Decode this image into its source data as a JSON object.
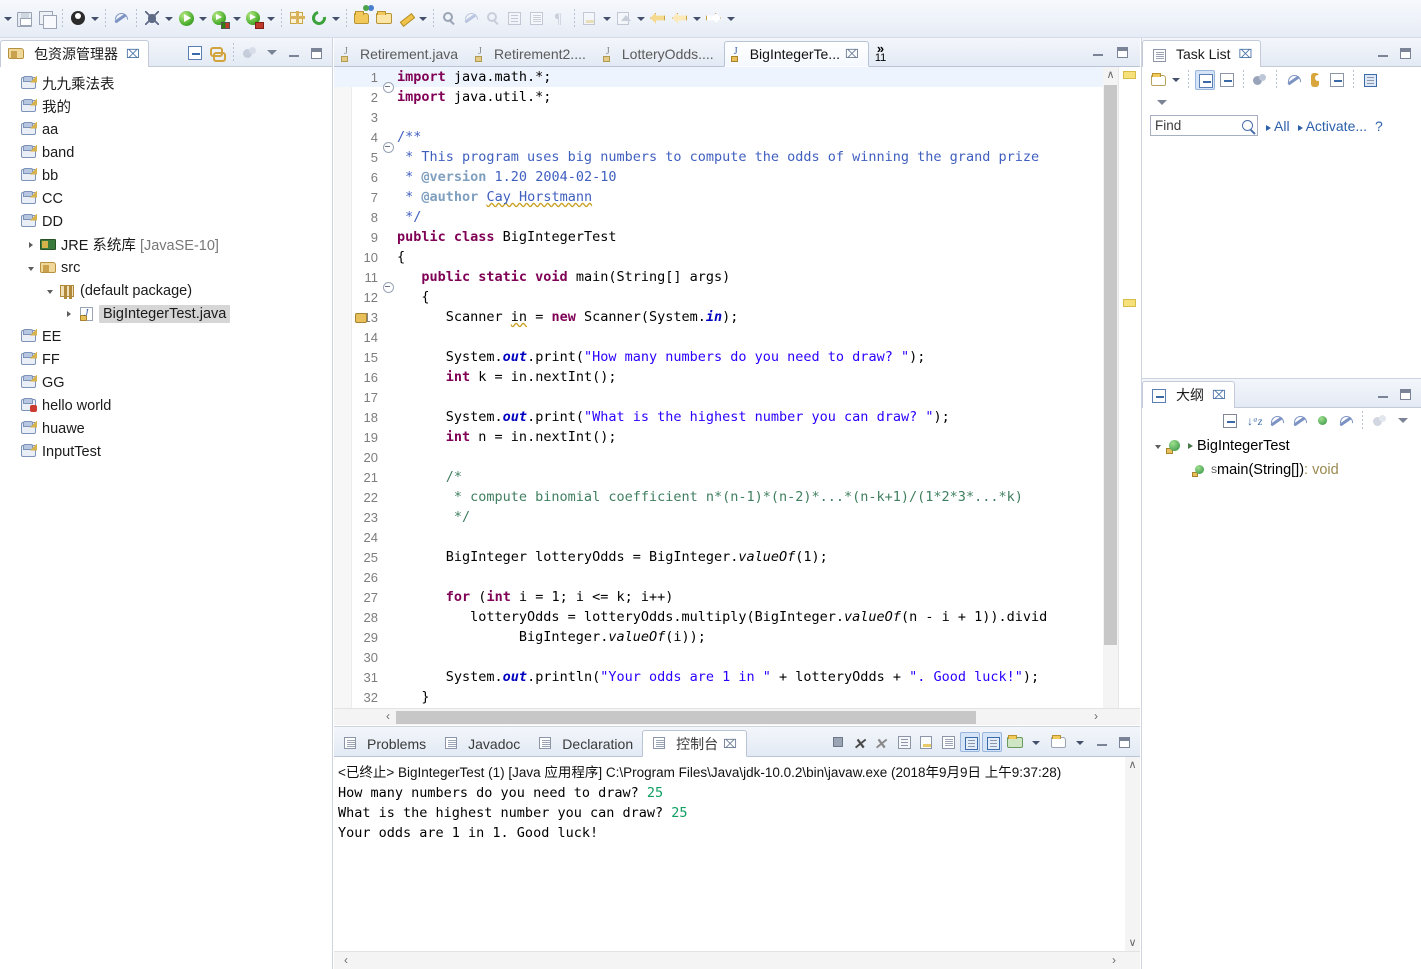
{
  "toolbar": {
    "items": [
      {
        "name": "dropdown-arrow-leading",
        "icon": "arrow"
      },
      {
        "name": "save-button",
        "icon": "save"
      },
      {
        "name": "save-all-button",
        "icon": "save-all"
      },
      {
        "name": "sep"
      },
      {
        "name": "skip-breakpoints-button",
        "icon": "person"
      },
      {
        "name": "dropdown-arrow",
        "icon": "arrow"
      },
      {
        "name": "sep"
      },
      {
        "name": "toggle-breakpoint-button",
        "icon": "pen"
      },
      {
        "name": "sep"
      },
      {
        "name": "debug-button",
        "icon": "bug"
      },
      {
        "name": "dropdown-arrow",
        "icon": "arrow"
      },
      {
        "name": "run-button",
        "icon": "run"
      },
      {
        "name": "dropdown-arrow",
        "icon": "arrow"
      },
      {
        "name": "run-coverage-button",
        "icon": "run-green"
      },
      {
        "name": "dropdown-arrow",
        "icon": "arrow"
      },
      {
        "name": "run-external-button",
        "icon": "run-red"
      },
      {
        "name": "dropdown-arrow",
        "icon": "arrow"
      },
      {
        "name": "sep"
      },
      {
        "name": "new-package-button",
        "icon": "gift"
      },
      {
        "name": "refresh-button",
        "icon": "refresh"
      },
      {
        "name": "dropdown-arrow",
        "icon": "arrow"
      },
      {
        "name": "sep"
      },
      {
        "name": "new-java-project-button",
        "icon": "new-folder"
      },
      {
        "name": "open-type-button",
        "icon": "open-folder"
      },
      {
        "name": "add-bookmark-button",
        "icon": "marker"
      },
      {
        "name": "dropdown-arrow",
        "icon": "arrow"
      },
      {
        "name": "sep"
      },
      {
        "name": "search-button",
        "icon": "search"
      },
      {
        "name": "profile-button",
        "icon": "faint-a"
      },
      {
        "name": "open-task-button",
        "icon": "faint-b"
      },
      {
        "name": "open-declaration-button",
        "icon": "book"
      },
      {
        "name": "show-whitespace-button",
        "icon": "lines"
      },
      {
        "name": "toggle-mark-occurrences-button",
        "icon": "pilcrow"
      },
      {
        "name": "sep"
      },
      {
        "name": "next-annotation-button",
        "icon": "next-annotation"
      },
      {
        "name": "dropdown-arrow",
        "icon": "arrow"
      },
      {
        "name": "last-edit-location-button",
        "icon": "last-edit"
      },
      {
        "name": "dropdown-arrow",
        "icon": "arrow"
      },
      {
        "name": "back-button",
        "icon": "back-yellow"
      },
      {
        "name": "back-history-button",
        "icon": "back-pale"
      },
      {
        "name": "dropdown-arrow",
        "icon": "arrow"
      },
      {
        "name": "forward-button",
        "icon": "forward"
      },
      {
        "name": "dropdown-arrow",
        "icon": "arrow"
      }
    ]
  },
  "package_explorer": {
    "title": "包资源管理器",
    "close_label": "⌧",
    "tools": [
      "collapse-all-icon",
      "link-with-editor-icon",
      "sync-icon",
      "view-menu-icon",
      "minimize-icon",
      "maximize-icon"
    ],
    "tree": [
      {
        "label": "九九乘法表",
        "icon": "project",
        "indent": 0,
        "twisty": "none",
        "selected": false
      },
      {
        "label": "我的",
        "icon": "project",
        "indent": 0,
        "twisty": "none",
        "selected": false
      },
      {
        "label": "aa",
        "icon": "project",
        "indent": 0,
        "twisty": "none",
        "selected": false
      },
      {
        "label": "band",
        "icon": "project",
        "indent": 0,
        "twisty": "none",
        "selected": false
      },
      {
        "label": "bb",
        "icon": "project",
        "indent": 0,
        "twisty": "none",
        "selected": false
      },
      {
        "label": "CC",
        "icon": "project",
        "indent": 0,
        "twisty": "none",
        "selected": false
      },
      {
        "label": "DD",
        "icon": "project",
        "indent": 0,
        "twisty": "none",
        "selected": false
      },
      {
        "label": "JRE 系统库",
        "dim": " [JavaSE-10]",
        "icon": "jre",
        "indent": 1,
        "twisty": "right",
        "selected": false
      },
      {
        "label": "src",
        "icon": "source-folder",
        "indent": 1,
        "twisty": "down",
        "selected": false
      },
      {
        "label": "(default package)",
        "icon": "package",
        "indent": 2,
        "twisty": "down",
        "selected": false
      },
      {
        "label": "BigIntegerTest.java",
        "icon": "java-file",
        "indent": 3,
        "twisty": "right",
        "selected": true
      },
      {
        "label": "EE",
        "icon": "project",
        "indent": 0,
        "twisty": "none",
        "selected": false
      },
      {
        "label": "FF",
        "icon": "project",
        "indent": 0,
        "twisty": "none",
        "selected": false
      },
      {
        "label": "GG",
        "icon": "project",
        "indent": 0,
        "twisty": "none",
        "selected": false
      },
      {
        "label": "hello world",
        "icon": "project-error",
        "indent": 0,
        "twisty": "none",
        "selected": false
      },
      {
        "label": "huawe",
        "icon": "project",
        "indent": 0,
        "twisty": "none",
        "selected": false
      },
      {
        "label": "InputTest",
        "icon": "project",
        "indent": 0,
        "twisty": "none",
        "selected": false
      }
    ]
  },
  "editor": {
    "tabs": [
      {
        "label": "Retirement.java",
        "active": false,
        "closeable": false
      },
      {
        "label": "Retirement2....",
        "active": false,
        "closeable": false
      },
      {
        "label": "LotteryOdds....",
        "active": false,
        "closeable": false
      },
      {
        "label": "BigIntegerTe...",
        "active": true,
        "closeable": true,
        "close_label": "⌧"
      }
    ],
    "more_tabs_chevron": "»",
    "more_tabs_count": "11",
    "restore_label": "restore-icon",
    "maximize_label": "maximize-icon",
    "lines": [
      {
        "n": "1",
        "fold": true,
        "highlight": true,
        "breakpoint": false,
        "tokens": [
          {
            "t": "import ",
            "c": "kw"
          },
          {
            "t": "java.math.*;",
            "c": ""
          }
        ]
      },
      {
        "n": "2",
        "fold": false,
        "highlight": false,
        "breakpoint": false,
        "tokens": [
          {
            "t": "import ",
            "c": "kw"
          },
          {
            "t": "java.util.*;",
            "c": ""
          }
        ]
      },
      {
        "n": "3",
        "fold": false,
        "highlight": false,
        "breakpoint": false,
        "tokens": []
      },
      {
        "n": "4",
        "fold": true,
        "highlight": false,
        "breakpoint": false,
        "tokens": [
          {
            "t": "/**",
            "c": "jdoc"
          }
        ]
      },
      {
        "n": "5",
        "fold": false,
        "highlight": false,
        "breakpoint": false,
        "tokens": [
          {
            "t": " * This program uses big numbers to compute the odds of winning the grand prize",
            "c": "jdoc"
          }
        ]
      },
      {
        "n": "6",
        "fold": false,
        "highlight": false,
        "breakpoint": false,
        "tokens": [
          {
            "t": " * ",
            "c": "jdoc"
          },
          {
            "t": "@version",
            "c": "jtag"
          },
          {
            "t": " 1.20 2004-02-10",
            "c": "jdoc"
          }
        ]
      },
      {
        "n": "7",
        "fold": false,
        "highlight": false,
        "breakpoint": false,
        "tokens": [
          {
            "t": " * ",
            "c": "jdoc"
          },
          {
            "t": "@author",
            "c": "jtag"
          },
          {
            "t": " ",
            "c": "jdoc"
          },
          {
            "t": "Cay Horstmann",
            "c": "jdoc spell"
          }
        ]
      },
      {
        "n": "8",
        "fold": false,
        "highlight": false,
        "breakpoint": false,
        "tokens": [
          {
            "t": " */",
            "c": "jdoc"
          }
        ]
      },
      {
        "n": "9",
        "fold": false,
        "highlight": false,
        "breakpoint": false,
        "tokens": [
          {
            "t": "public class ",
            "c": "kw"
          },
          {
            "t": "BigIntegerTest",
            "c": ""
          }
        ]
      },
      {
        "n": "10",
        "fold": false,
        "highlight": false,
        "breakpoint": false,
        "tokens": [
          {
            "t": "{",
            "c": ""
          }
        ]
      },
      {
        "n": "11",
        "fold": true,
        "highlight": false,
        "breakpoint": false,
        "tokens": [
          {
            "t": "   ",
            "c": ""
          },
          {
            "t": "public static void ",
            "c": "kw"
          },
          {
            "t": "main(String[] args)",
            "c": ""
          }
        ]
      },
      {
        "n": "12",
        "fold": false,
        "highlight": false,
        "breakpoint": false,
        "tokens": [
          {
            "t": "   {",
            "c": ""
          }
        ]
      },
      {
        "n": "13",
        "fold": false,
        "highlight": false,
        "breakpoint": true,
        "tokens": [
          {
            "t": "      Scanner ",
            "c": ""
          },
          {
            "t": "in",
            "c": "spell"
          },
          {
            "t": " = ",
            "c": ""
          },
          {
            "t": "new ",
            "c": "kw"
          },
          {
            "t": "Scanner(System.",
            "c": ""
          },
          {
            "t": "in",
            "c": "fld"
          },
          {
            "t": ");",
            "c": ""
          }
        ]
      },
      {
        "n": "14",
        "fold": false,
        "highlight": false,
        "breakpoint": false,
        "tokens": []
      },
      {
        "n": "15",
        "fold": false,
        "highlight": false,
        "breakpoint": false,
        "tokens": [
          {
            "t": "      System.",
            "c": ""
          },
          {
            "t": "out",
            "c": "fld"
          },
          {
            "t": ".print(",
            "c": ""
          },
          {
            "t": "\"How many numbers do you need to draw? \"",
            "c": "str"
          },
          {
            "t": ");",
            "c": ""
          }
        ]
      },
      {
        "n": "16",
        "fold": false,
        "highlight": false,
        "breakpoint": false,
        "tokens": [
          {
            "t": "      ",
            "c": ""
          },
          {
            "t": "int ",
            "c": "kw"
          },
          {
            "t": "k = in.nextInt();",
            "c": ""
          }
        ]
      },
      {
        "n": "17",
        "fold": false,
        "highlight": false,
        "breakpoint": false,
        "tokens": []
      },
      {
        "n": "18",
        "fold": false,
        "highlight": false,
        "breakpoint": false,
        "tokens": [
          {
            "t": "      System.",
            "c": ""
          },
          {
            "t": "out",
            "c": "fld"
          },
          {
            "t": ".print(",
            "c": ""
          },
          {
            "t": "\"What is the highest number you can draw? \"",
            "c": "str"
          },
          {
            "t": ");",
            "c": ""
          }
        ]
      },
      {
        "n": "19",
        "fold": false,
        "highlight": false,
        "breakpoint": false,
        "tokens": [
          {
            "t": "      ",
            "c": ""
          },
          {
            "t": "int ",
            "c": "kw"
          },
          {
            "t": "n = in.nextInt();",
            "c": ""
          }
        ]
      },
      {
        "n": "20",
        "fold": false,
        "highlight": false,
        "breakpoint": false,
        "tokens": []
      },
      {
        "n": "21",
        "fold": false,
        "highlight": false,
        "breakpoint": false,
        "tokens": [
          {
            "t": "      /*",
            "c": "cmt"
          }
        ]
      },
      {
        "n": "22",
        "fold": false,
        "highlight": false,
        "breakpoint": false,
        "tokens": [
          {
            "t": "       * compute binomial coefficient n*(n-1)*(n-2)*...*(n-k+1)/(1*2*3*...*k)",
            "c": "cmt"
          }
        ]
      },
      {
        "n": "23",
        "fold": false,
        "highlight": false,
        "breakpoint": false,
        "tokens": [
          {
            "t": "       */",
            "c": "cmt"
          }
        ]
      },
      {
        "n": "24",
        "fold": false,
        "highlight": false,
        "breakpoint": false,
        "tokens": []
      },
      {
        "n": "25",
        "fold": false,
        "highlight": false,
        "breakpoint": false,
        "tokens": [
          {
            "t": "      BigInteger lotteryOdds = BigInteger.",
            "c": ""
          },
          {
            "t": "valueOf",
            "c": "mth"
          },
          {
            "t": "(1);",
            "c": ""
          }
        ]
      },
      {
        "n": "26",
        "fold": false,
        "highlight": false,
        "breakpoint": false,
        "tokens": []
      },
      {
        "n": "27",
        "fold": false,
        "highlight": false,
        "breakpoint": false,
        "tokens": [
          {
            "t": "      ",
            "c": ""
          },
          {
            "t": "for ",
            "c": "kw"
          },
          {
            "t": "(",
            "c": ""
          },
          {
            "t": "int ",
            "c": "kw"
          },
          {
            "t": "i = 1; i <= k; i++)",
            "c": ""
          }
        ]
      },
      {
        "n": "28",
        "fold": false,
        "highlight": false,
        "breakpoint": false,
        "tokens": [
          {
            "t": "         lotteryOdds = lotteryOdds.multiply(BigInteger.",
            "c": ""
          },
          {
            "t": "valueOf",
            "c": "mth"
          },
          {
            "t": "(n - i + 1)).divid",
            "c": ""
          }
        ]
      },
      {
        "n": "29",
        "fold": false,
        "highlight": false,
        "breakpoint": false,
        "tokens": [
          {
            "t": "               BigInteger.",
            "c": ""
          },
          {
            "t": "valueOf",
            "c": "mth"
          },
          {
            "t": "(i));",
            "c": ""
          }
        ]
      },
      {
        "n": "30",
        "fold": false,
        "highlight": false,
        "breakpoint": false,
        "tokens": []
      },
      {
        "n": "31",
        "fold": false,
        "highlight": false,
        "breakpoint": false,
        "tokens": [
          {
            "t": "      System.",
            "c": ""
          },
          {
            "t": "out",
            "c": "fld"
          },
          {
            "t": ".println(",
            "c": ""
          },
          {
            "t": "\"Your odds are 1 in \"",
            "c": "str"
          },
          {
            "t": " + lotteryOdds + ",
            "c": ""
          },
          {
            "t": "\". Good luck!\"",
            "c": "str"
          },
          {
            "t": ");",
            "c": ""
          }
        ]
      },
      {
        "n": "32",
        "fold": false,
        "highlight": false,
        "breakpoint": false,
        "tokens": [
          {
            "t": "   }",
            "c": ""
          }
        ]
      }
    ],
    "scroll_up": "∧",
    "scroll_down": "∨",
    "scroll_left": "‹",
    "scroll_right": "›"
  },
  "task_list": {
    "title": "Task List",
    "close_label": "⌧",
    "tools": [
      "new-task-icon",
      "dropdown-arrow-icon",
      "categorized-icon",
      "scheduled-icon",
      "synchronize-icon",
      "collapse-filter-icon",
      "focus-active-icon",
      "collapse-all-icon",
      "restore-tasks-icon",
      "view-menu-icon"
    ],
    "find_placeholder": "Find",
    "search_icon": "magnifier-icon",
    "filter_all": "All",
    "filter_activate": "Activate...",
    "help_icon": "?",
    "minimize_label": "minimize-icon",
    "maximize_label": "maximize-icon"
  },
  "outline": {
    "title": "大纲",
    "close_label": "⌧",
    "tools": [
      "collapse-all-icon",
      "sort-icon",
      "hide-fields-icon",
      "hide-static-icon",
      "hide-nonpublic-icon",
      "hide-local-icon",
      "link-icon",
      "view-menu-icon"
    ],
    "minimize_label": "minimize-icon",
    "maximize_label": "maximize-icon",
    "nodes": [
      {
        "label": "BigIntegerTest",
        "type": "class",
        "twisty": "down",
        "indent": 0
      },
      {
        "label": "main(String[])",
        "suffix": " : void",
        "type": "method",
        "static_marker": "S",
        "twisty": "none",
        "indent": 1
      }
    ]
  },
  "console": {
    "tabs": [
      {
        "label": "Problems",
        "icon": "problems-icon",
        "active": false
      },
      {
        "label": "Javadoc",
        "icon": "javadoc-icon",
        "active": false
      },
      {
        "label": "Declaration",
        "icon": "declaration-icon",
        "active": false
      },
      {
        "label": "控制台",
        "icon": "console-icon",
        "active": true,
        "close_label": "⌧"
      }
    ],
    "tools": [
      "terminate-icon",
      "remove-launch-icon",
      "remove-all-launches-icon",
      "clear-console-icon",
      "lock-scroll-icon",
      "show-console-on-output-icon",
      "pin-console-icon",
      "display-selected-console-icon",
      "open-console-icon",
      "dropdown-arrow-icon",
      "new-console-view-icon",
      "dropdown-arrow-icon-2",
      "minimize-icon",
      "maximize-icon"
    ],
    "header": "<已终止> BigIntegerTest (1)  [Java 应用程序] C:\\Program Files\\Java\\jdk-10.0.2\\bin\\javaw.exe  (2018年9月9日 上午9:37:28)",
    "output": [
      {
        "prompt": "How many numbers do you need to draw? ",
        "input": "25"
      },
      {
        "prompt": "What is the highest number you can draw? ",
        "input": "25"
      },
      {
        "prompt": "Your odds are 1 in 1. Good luck!",
        "input": ""
      }
    ],
    "scroll_up": "∧",
    "scroll_down": "∨",
    "scroll_left": "‹",
    "scroll_right": "›"
  },
  "colors": {
    "accent": "#2b5faa",
    "keyword": "#7f0055",
    "string": "#2a00ff",
    "comment": "#3f7f5f",
    "javadoc": "#3f5fbf",
    "console_input": "#0f9e62",
    "selection": "#d6d6d6"
  }
}
